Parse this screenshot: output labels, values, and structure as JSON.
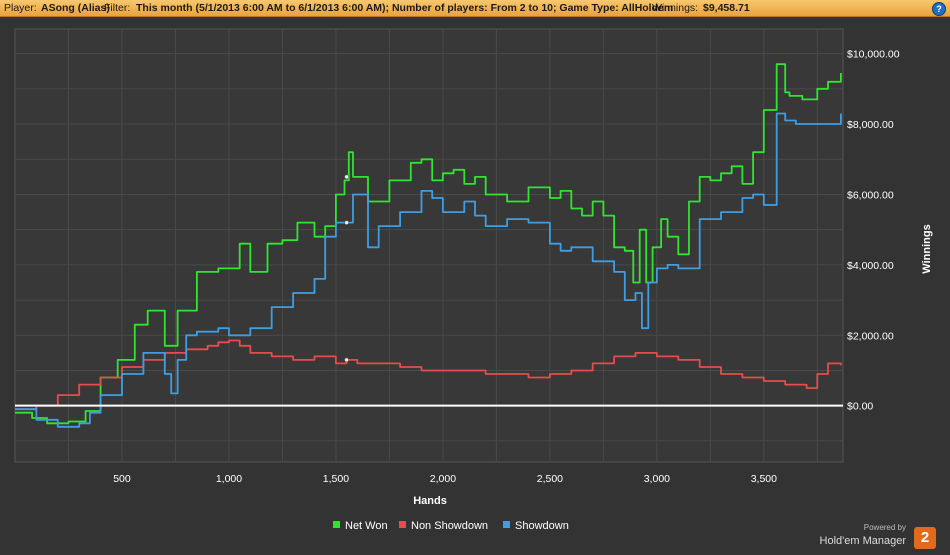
{
  "header": {
    "player_label": "Player:",
    "player_value": "ASong (Alias)",
    "filter_label": "Filter:",
    "filter_value": "This month (5/1/2013 6:00 AM to 6/1/2013 6:00 AM); Number of players: From 2 to 10; Game Type: AllHoldem",
    "winnings_label": "Winnings:",
    "winnings_value": "$9,458.71",
    "help_icon": "?"
  },
  "brand": {
    "powered_by": "Powered by",
    "name": "Hold'em Manager",
    "badge": "2"
  },
  "chart_data": {
    "type": "line",
    "xlabel": "Hands",
    "ylabel": "Winnings",
    "xlim": [
      0,
      3870
    ],
    "ylim": [
      -1600,
      10700
    ],
    "x_ticks": [
      500,
      1000,
      1500,
      2000,
      2500,
      3000,
      3500
    ],
    "x_tick_labels": [
      "500",
      "1,000",
      "1,500",
      "2,000",
      "2,500",
      "3,000",
      "3,500"
    ],
    "y_ticks": [
      0,
      2000,
      4000,
      6000,
      8000,
      10000
    ],
    "y_tick_labels": [
      "$0.00",
      "$2,000.00",
      "$4,000.00",
      "$6,000.00",
      "$8,000.00",
      "$10,000.00"
    ],
    "grid": true,
    "legend_position": "bottom-center",
    "zero_line_color": "#ffffff",
    "series": [
      {
        "name": "Net Won",
        "color": "#2ee62e",
        "x": [
          0,
          80,
          150,
          250,
          330,
          400,
          480,
          560,
          620,
          700,
          760,
          850,
          950,
          1050,
          1100,
          1180,
          1250,
          1320,
          1400,
          1450,
          1500,
          1540,
          1560,
          1580,
          1650,
          1750,
          1850,
          1900,
          1950,
          2000,
          2050,
          2100,
          2150,
          2200,
          2300,
          2400,
          2500,
          2550,
          2600,
          2650,
          2700,
          2750,
          2800,
          2850,
          2890,
          2920,
          2950,
          2980,
          3020,
          3050,
          3100,
          3150,
          3200,
          3250,
          3300,
          3350,
          3400,
          3450,
          3500,
          3560,
          3600,
          3620,
          3680,
          3750,
          3800,
          3860
        ],
        "y": [
          -200,
          -350,
          -500,
          -450,
          -150,
          800,
          1300,
          2300,
          2700,
          1700,
          2700,
          3800,
          3900,
          4600,
          3800,
          4600,
          4700,
          5200,
          4800,
          5100,
          6000,
          6400,
          7200,
          6500,
          5800,
          6400,
          6900,
          7000,
          6400,
          6600,
          6700,
          6300,
          6500,
          6000,
          5800,
          6200,
          5900,
          6100,
          5600,
          5400,
          5800,
          5400,
          4500,
          4400,
          3500,
          5000,
          3500,
          4500,
          5300,
          4800,
          4300,
          5800,
          6500,
          6400,
          6600,
          6800,
          6300,
          7200,
          8400,
          9700,
          8900,
          8800,
          8700,
          9000,
          9200,
          9450
        ]
      },
      {
        "name": "Non Showdown",
        "color": "#e54c4c",
        "x": [
          0,
          100,
          200,
          300,
          400,
          500,
          600,
          700,
          800,
          900,
          950,
          1000,
          1050,
          1100,
          1200,
          1300,
          1400,
          1500,
          1550,
          1600,
          1700,
          1800,
          1900,
          2000,
          2100,
          2200,
          2300,
          2400,
          2500,
          2600,
          2700,
          2800,
          2900,
          3000,
          3100,
          3200,
          3300,
          3400,
          3500,
          3600,
          3700,
          3750,
          3800,
          3860
        ],
        "y": [
          -100,
          0,
          300,
          600,
          800,
          1100,
          1300,
          1500,
          1600,
          1700,
          1800,
          1850,
          1700,
          1500,
          1400,
          1300,
          1400,
          1200,
          1300,
          1200,
          1200,
          1100,
          1000,
          1000,
          1000,
          900,
          900,
          800,
          900,
          1000,
          1200,
          1400,
          1500,
          1400,
          1300,
          1100,
          900,
          800,
          700,
          600,
          500,
          900,
          1200,
          1150
        ]
      },
      {
        "name": "Showdown",
        "color": "#3e9ee4",
        "x": [
          0,
          100,
          200,
          300,
          350,
          400,
          500,
          600,
          700,
          730,
          760,
          800,
          850,
          950,
          1000,
          1100,
          1200,
          1300,
          1400,
          1450,
          1500,
          1550,
          1580,
          1650,
          1700,
          1800,
          1900,
          1950,
          2000,
          2100,
          2150,
          2200,
          2300,
          2400,
          2500,
          2550,
          2600,
          2700,
          2800,
          2850,
          2900,
          2930,
          2960,
          3000,
          3050,
          3100,
          3200,
          3300,
          3400,
          3450,
          3500,
          3560,
          3600,
          3650,
          3750,
          3860
        ],
        "y": [
          -100,
          -400,
          -600,
          -500,
          -200,
          300,
          900,
          1500,
          900,
          350,
          1300,
          2000,
          2100,
          2200,
          2000,
          2200,
          2800,
          3200,
          3600,
          4800,
          5200,
          5200,
          6000,
          4500,
          5100,
          5500,
          6100,
          5900,
          5500,
          5800,
          5400,
          5100,
          5300,
          5200,
          4600,
          4400,
          4500,
          4100,
          3800,
          3000,
          3200,
          2200,
          3500,
          3900,
          4000,
          3900,
          5300,
          5500,
          5900,
          6000,
          5700,
          8300,
          8100,
          8000,
          8000,
          8300
        ]
      }
    ],
    "markers": [
      {
        "series": "Net Won",
        "x": 1550,
        "y": 6500
      },
      {
        "series": "Showdown",
        "x": 1550,
        "y": 5200
      },
      {
        "series": "Non Showdown",
        "x": 1550,
        "y": 1300
      }
    ]
  }
}
